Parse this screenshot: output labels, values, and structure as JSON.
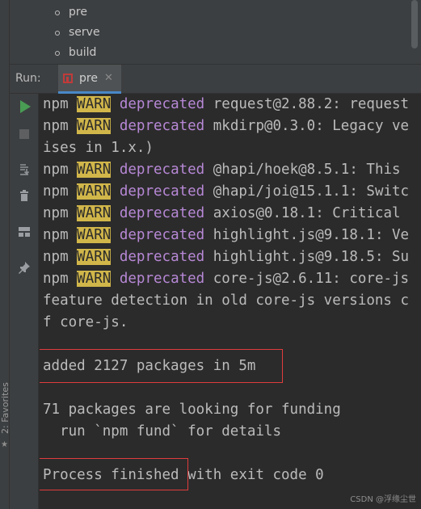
{
  "scripts_panel": {
    "items": [
      {
        "label": "pre"
      },
      {
        "label": "serve"
      },
      {
        "label": "build"
      }
    ]
  },
  "run_window": {
    "label": "Run:",
    "tab": {
      "label": "pre",
      "close": "✕"
    }
  },
  "left_gutter": {
    "favorites_label": "2: Favorites"
  },
  "console": {
    "lines": [
      {
        "prefix": "npm",
        "level": "WARN",
        "tag": "deprecated",
        "text": "request@2.88.2: request"
      },
      {
        "prefix": "npm",
        "level": "WARN",
        "tag": "deprecated",
        "text": "mkdirp@0.3.0: Legacy ve"
      },
      {
        "text": "ises in 1.x.)"
      },
      {
        "prefix": "npm",
        "level": "WARN",
        "tag": "deprecated",
        "text": "@hapi/hoek@8.5.1: This"
      },
      {
        "prefix": "npm",
        "level": "WARN",
        "tag": "deprecated",
        "text": "@hapi/joi@15.1.1: Switc"
      },
      {
        "prefix": "npm",
        "level": "WARN",
        "tag": "deprecated",
        "text": "axios@0.18.1: Critical"
      },
      {
        "prefix": "npm",
        "level": "WARN",
        "tag": "deprecated",
        "text": "highlight.js@9.18.1: Ve"
      },
      {
        "prefix": "npm",
        "level": "WARN",
        "tag": "deprecated",
        "text": "highlight.js@9.18.5: Su"
      },
      {
        "prefix": "npm",
        "level": "WARN",
        "tag": "deprecated",
        "text": "core-js@2.6.11: core-js"
      },
      {
        "text": "feature detection in old core-js versions c"
      },
      {
        "text": "f core-js."
      },
      {
        "text": ""
      },
      {
        "text": "added 2127 packages in 5m"
      },
      {
        "text": ""
      },
      {
        "text": "71 packages are looking for funding"
      },
      {
        "text": "  run `npm fund` for details"
      },
      {
        "text": ""
      },
      {
        "text": "Process finished",
        "suffix": " with exit code 0"
      }
    ]
  },
  "watermark": "CSDN @浮缘尘世",
  "colors": {
    "background": "#2b2b2b",
    "panel": "#3c3f41",
    "warn_bg": "#d1b64a",
    "deprecated": "#b788d6",
    "highlight_box": "#e03c3c",
    "run_green": "#499c54"
  },
  "icons": {
    "run": "play-icon",
    "stop": "stop-icon",
    "scroll_to_end": "scroll-to-end-icon",
    "clear": "trash-icon",
    "layout": "layout-icon",
    "pin": "pin-icon",
    "favorites": "star-icon"
  }
}
